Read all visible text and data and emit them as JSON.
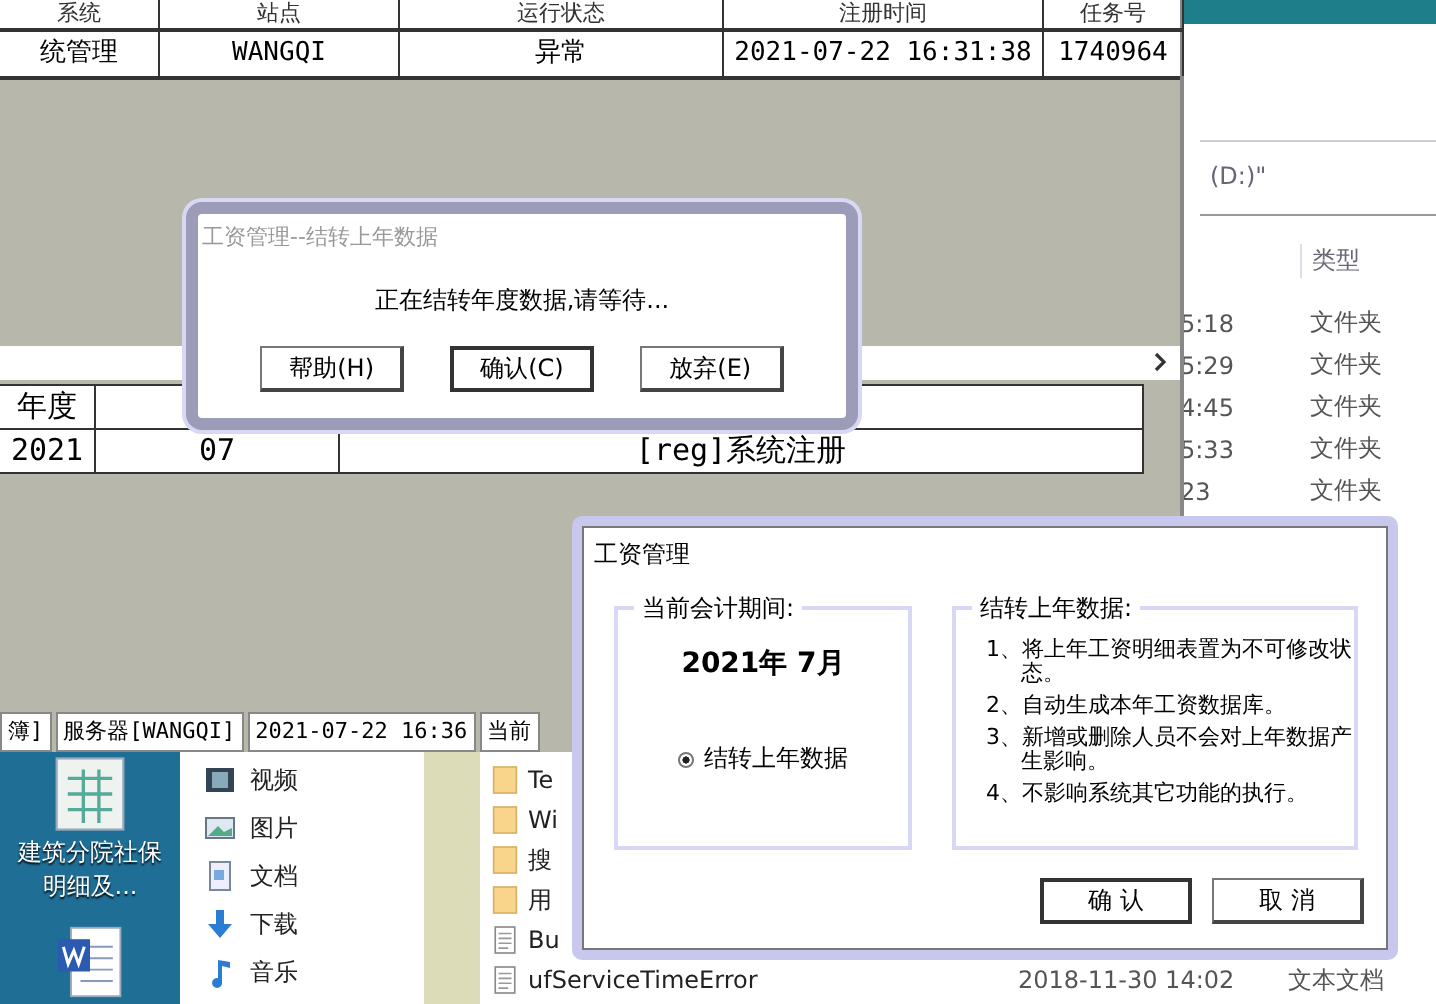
{
  "explorer": {
    "address": "(D:)\"",
    "type_header": "类型",
    "top_rows": [
      {
        "time": "5:18",
        "type": "文件夹"
      },
      {
        "time": "5:29",
        "type": "文件夹"
      },
      {
        "time": "4:45",
        "type": "文件夹"
      },
      {
        "time": "5:33",
        "type": "文件夹"
      },
      {
        "time": "23",
        "type": "文件夹"
      }
    ],
    "nav_items": [
      {
        "label": "视频",
        "kind": "video"
      },
      {
        "label": "图片",
        "kind": "picture"
      },
      {
        "label": "文档",
        "kind": "document"
      },
      {
        "label": "下载",
        "kind": "download"
      },
      {
        "label": "音乐",
        "kind": "music"
      }
    ],
    "files": [
      {
        "name": "Te",
        "kind": "folder"
      },
      {
        "name": "Wi",
        "kind": "folder"
      },
      {
        "name": "搜",
        "kind": "folder"
      },
      {
        "name": "用",
        "kind": "folder"
      },
      {
        "name": "Bu",
        "kind": "text"
      },
      {
        "name": "ufServiceTimeError",
        "kind": "text",
        "modified": "2018-11-30 14:02",
        "type": "文本文档"
      }
    ]
  },
  "desktop_icons": [
    {
      "kind": "sheet",
      "label": "建筑分院社保明细及..."
    },
    {
      "kind": "word"
    }
  ],
  "app_window": {
    "table": {
      "columns": [
        "系统",
        "站点",
        "运行状态",
        "注册时间",
        "任务号"
      ],
      "rows": [
        [
          "统管理",
          "WANGQI",
          "异常",
          "2021-07-22 16:31:38",
          "1740964"
        ]
      ]
    },
    "log_table": {
      "columns": [
        "年度"
      ],
      "rows": [
        [
          "2021",
          "07",
          "[reg]系统注册"
        ]
      ]
    },
    "status_bar": [
      "簿]",
      "服务器[WANGQI]",
      "2021-07-22 16:36",
      "当前"
    ]
  },
  "progress_dialog": {
    "title": "工资管理--结转上年数据",
    "message": "正在结转年度数据,请等待...",
    "buttons": [
      {
        "label": "帮助(H)",
        "focused": false
      },
      {
        "label": "确认(C)",
        "focused": true
      },
      {
        "label": "放弃(E)",
        "focused": false
      }
    ]
  },
  "carry_dialog": {
    "title": "工资管理",
    "period_group": {
      "title": "当前会计期间:",
      "period": "2021年  7月",
      "option": {
        "label": "结转上年数据",
        "selected": true
      }
    },
    "info_group": {
      "title": "结转上年数据:",
      "items": [
        "1、将上年工资明细表置为不可修改状态。",
        "2、自动生成本年工资数据库。",
        "3、新增或删除人员不会对上年数据产生影响。",
        "4、不影响系统其它功能的执行。"
      ]
    },
    "buttons": [
      {
        "label": "确 认",
        "focused": true
      },
      {
        "label": "取 消",
        "focused": false
      }
    ]
  }
}
